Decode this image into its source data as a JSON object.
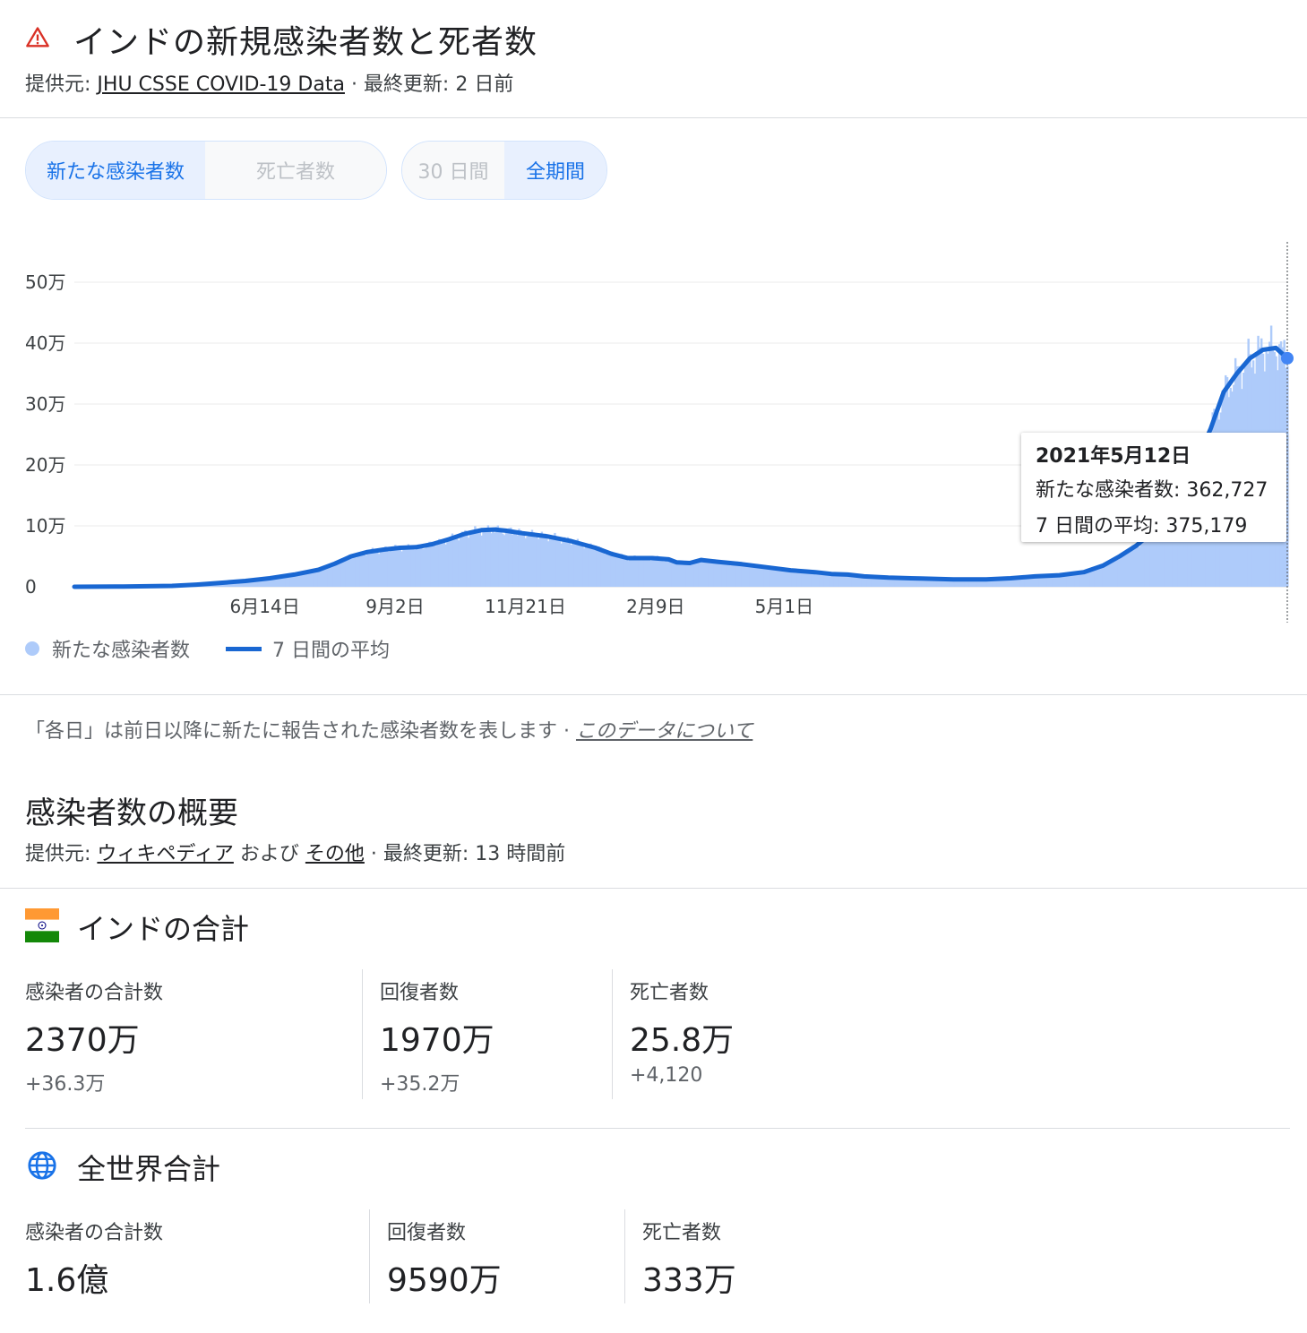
{
  "header": {
    "title": "インドの新規感染者数と死者数",
    "source_prefix": "提供元: ",
    "source_link": "JHU CSSE COVID-19 Data",
    "source_suffix": " · 最終更新: 2 日前"
  },
  "filters": {
    "metric": [
      "新たな感染者数",
      "死亡者数"
    ],
    "period": [
      "30 日間",
      "全期間"
    ]
  },
  "chart_data": {
    "type": "bar",
    "y_ticks": [
      "0",
      "10万",
      "20万",
      "30万",
      "40万",
      "50万"
    ],
    "x_ticks": [
      "6月14日",
      "9月2日",
      "11月21日",
      "2月9日",
      "5月1日"
    ],
    "ylim": [
      0,
      500000
    ],
    "legend": [
      "新たな感染者数",
      "7 日間の平均"
    ],
    "grid": true,
    "series": [
      {
        "name": "7 日間の平均",
        "points": [
          [
            0,
            0
          ],
          [
            30,
            400
          ],
          [
            60,
            1500
          ],
          [
            75,
            3500
          ],
          [
            90,
            6500
          ],
          [
            105,
            9500
          ],
          [
            120,
            14000
          ],
          [
            135,
            20000
          ],
          [
            150,
            28000
          ],
          [
            160,
            38000
          ],
          [
            170,
            50000
          ],
          [
            180,
            57000
          ],
          [
            190,
            61000
          ],
          [
            200,
            64000
          ],
          [
            210,
            65000
          ],
          [
            220,
            70000
          ],
          [
            230,
            78000
          ],
          [
            240,
            87000
          ],
          [
            250,
            93000
          ],
          [
            258,
            94000
          ],
          [
            265,
            92000
          ],
          [
            275,
            88000
          ],
          [
            290,
            83000
          ],
          [
            305,
            75000
          ],
          [
            320,
            64000
          ],
          [
            330,
            54000
          ],
          [
            340,
            47000
          ],
          [
            355,
            47000
          ],
          [
            365,
            45000
          ],
          [
            370,
            40000
          ],
          [
            378,
            39000
          ],
          [
            385,
            44000
          ],
          [
            395,
            41000
          ],
          [
            410,
            37000
          ],
          [
            425,
            32000
          ],
          [
            440,
            27000
          ],
          [
            455,
            24000
          ],
          [
            465,
            21000
          ],
          [
            475,
            20000
          ],
          [
            485,
            17000
          ],
          [
            500,
            15000
          ],
          [
            520,
            13500
          ],
          [
            540,
            12000
          ],
          [
            560,
            12000
          ],
          [
            575,
            14000
          ],
          [
            590,
            17000
          ],
          [
            605,
            19000
          ],
          [
            620,
            24000
          ],
          [
            632,
            35000
          ],
          [
            642,
            50000
          ],
          [
            652,
            67000
          ],
          [
            660,
            85000
          ],
          [
            668,
            110000
          ],
          [
            676,
            135000
          ],
          [
            683,
            165000
          ],
          [
            690,
            210000
          ],
          [
            698,
            260000
          ],
          [
            706,
            320000
          ],
          [
            714,
            350000
          ],
          [
            722,
            375000
          ],
          [
            730,
            389000
          ],
          [
            738,
            392000
          ],
          [
            745,
            375179
          ]
        ]
      }
    ]
  },
  "tooltip": {
    "date": "2021年5月12日",
    "new_cases": "新たな感染者数: 362,727",
    "avg": "7 日間の平均: 375,179"
  },
  "note": {
    "text": "「各日」は前日以降に新たに報告された感染者数を表します · ",
    "link": "このデータについて"
  },
  "summary": {
    "title": "感染者数の概要",
    "source_prefix": "提供元: ",
    "link1": "ウィキペディア",
    "middle": " および ",
    "link2": "その他",
    "suffix": " · 最終更新: 13 時間前"
  },
  "india": {
    "title": "インドの合計",
    "stats": [
      {
        "label": "感染者の合計数",
        "value": "2370万",
        "delta": "+36.3万"
      },
      {
        "label": "回復者数",
        "value": "1970万",
        "delta": "+35.2万"
      },
      {
        "label": "死亡者数",
        "value": "25.8万",
        "delta": "+4,120"
      }
    ]
  },
  "world": {
    "title": "全世界合計",
    "stats": [
      {
        "label": "感染者の合計数",
        "value": "1.6億"
      },
      {
        "label": "回復者数",
        "value": "9590万"
      },
      {
        "label": "死亡者数",
        "value": "333万"
      }
    ]
  },
  "colors": {
    "bar": "#aecbfa",
    "line": "#1967d2",
    "accent": "#1a73e8",
    "warning": "#d93025"
  }
}
